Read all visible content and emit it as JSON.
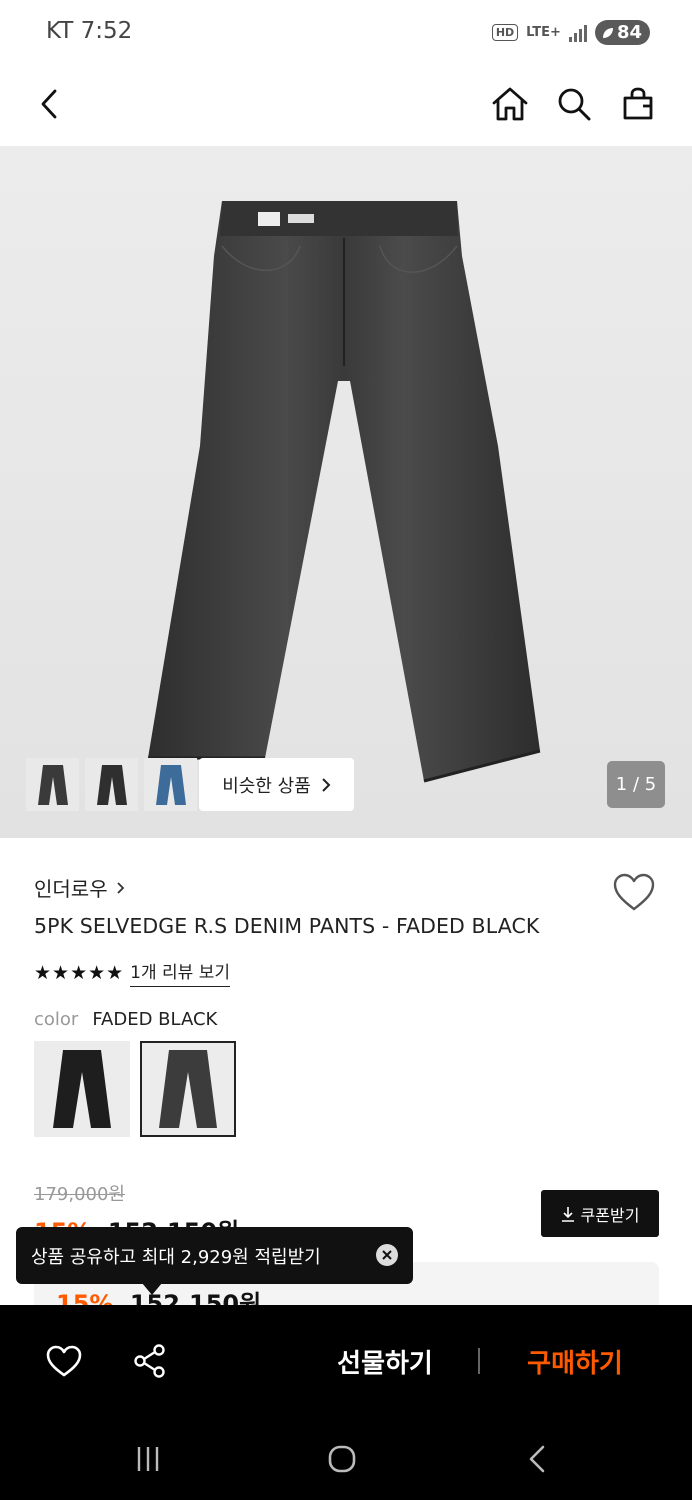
{
  "status": {
    "carrier_time": "KT 7:52",
    "hd": "HD",
    "lte": "LTE+",
    "battery": "84"
  },
  "nav": {
    "back_icon": "chevron-left-icon",
    "home_icon": "home-icon",
    "search_icon": "search-icon",
    "cart_icon": "shopping-bag-icon"
  },
  "gallery": {
    "similar_label": "비슷한 상품",
    "page_counter": "1 / 5",
    "thumbnails": [
      "faded-black-jeans",
      "faded-black-jeans",
      "blue-jeans"
    ]
  },
  "product": {
    "brand": "인더로우",
    "title": "5PK SELVEDGE R.S DENIM PANTS - FADED BLACK",
    "stars": "★★★★★",
    "rating": 5,
    "review_link": "1개 리뷰 보기",
    "color_label": "color",
    "color_value": "FADED BLACK"
  },
  "price": {
    "original": "179,000원",
    "sale_percent": "15%",
    "sale_price": "152,150원",
    "coupon_button": "쿠폰받기"
  },
  "tooltip": {
    "text": "상품 공유하고 최대 2,929원 적립받기"
  },
  "bottom_bar": {
    "gift_label": "선물하기",
    "buy_label": "구매하기"
  },
  "colors": {
    "accent": "#ff5a00",
    "bottom_bar": "#000000",
    "tooltip": "#111111"
  }
}
